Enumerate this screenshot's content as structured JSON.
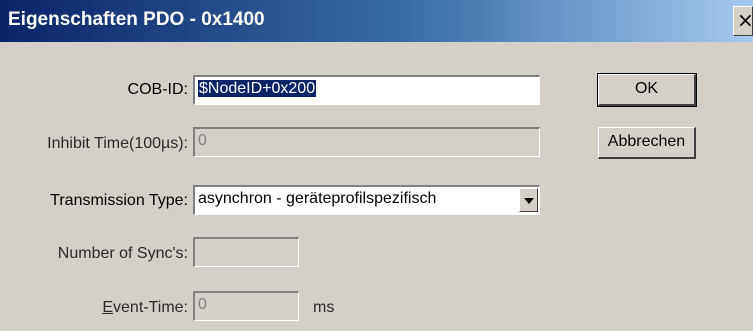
{
  "window": {
    "title": "Eigenschaften PDO - 0x1400",
    "close_glyph": "×"
  },
  "form": {
    "cob_id": {
      "label": "COB-ID:",
      "value": "$NodeID+0x200"
    },
    "inhibit_time": {
      "label": "Inhibit Time(100µs):",
      "value": "0"
    },
    "transmission_type": {
      "label": "Transmission Type:",
      "value": "asynchron - geräteprofilspezifisch"
    },
    "num_sync": {
      "label": "Number of Sync's:",
      "value": ""
    },
    "event_time": {
      "label_prefix": "E",
      "label_rest": "vent-Time:",
      "value": "0",
      "unit": "ms"
    }
  },
  "buttons": {
    "ok": "OK",
    "cancel": "Abbrechen"
  },
  "colors": {
    "title_start": "#0a246a",
    "title_end": "#a6caf0",
    "dialog_bg": "#d4d0c8",
    "selection": "#0a246a"
  }
}
